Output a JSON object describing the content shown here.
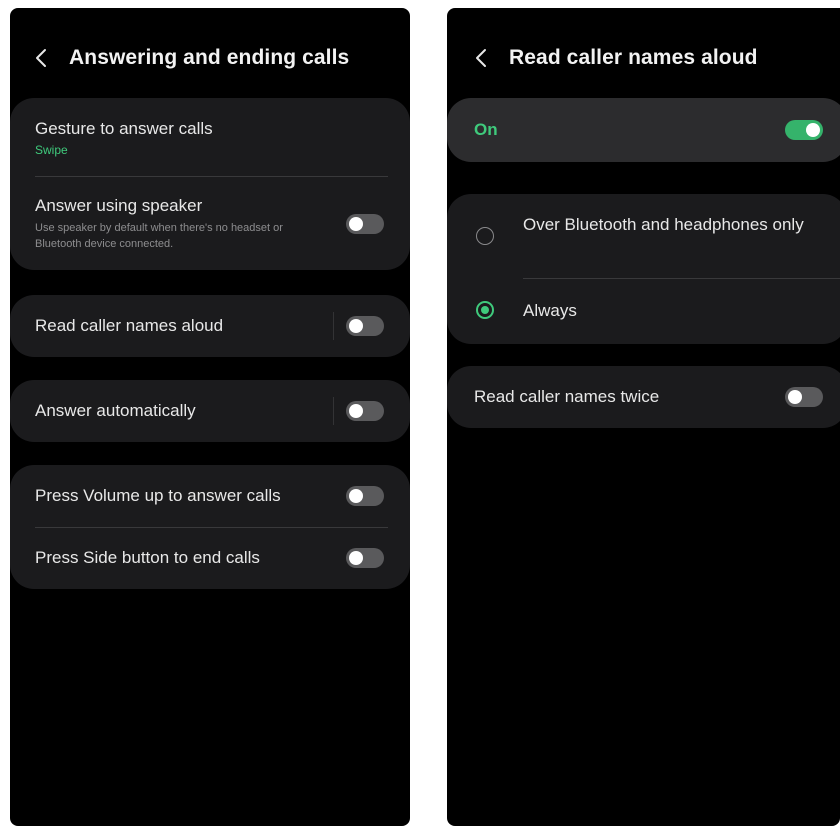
{
  "left_screen": {
    "title": "Answering and ending calls",
    "gesture": {
      "label": "Gesture to answer calls",
      "value": "Swipe"
    },
    "speaker": {
      "label": "Answer using speaker",
      "description": "Use speaker by default when there's no headset or Bluetooth device connected.",
      "enabled": false
    },
    "read_names": {
      "label": "Read caller names aloud",
      "enabled": false
    },
    "answer_auto": {
      "label": "Answer automatically",
      "enabled": false
    },
    "volume_up": {
      "label": "Press Volume up to answer calls",
      "enabled": false
    },
    "side_button": {
      "label": "Press Side button to end calls",
      "enabled": false
    }
  },
  "right_screen": {
    "title": "Read caller names aloud",
    "master": {
      "label": "On",
      "enabled": true
    },
    "options": [
      {
        "label": "Over Bluetooth and headphones only",
        "selected": false
      },
      {
        "label": "Always",
        "selected": true
      }
    ],
    "twice": {
      "label": "Read caller names twice",
      "enabled": false
    }
  },
  "colors": {
    "accent": "#3fca7c",
    "card": "#1b1b1d",
    "background": "#000000",
    "toggle_off": "#5a5a5c"
  }
}
